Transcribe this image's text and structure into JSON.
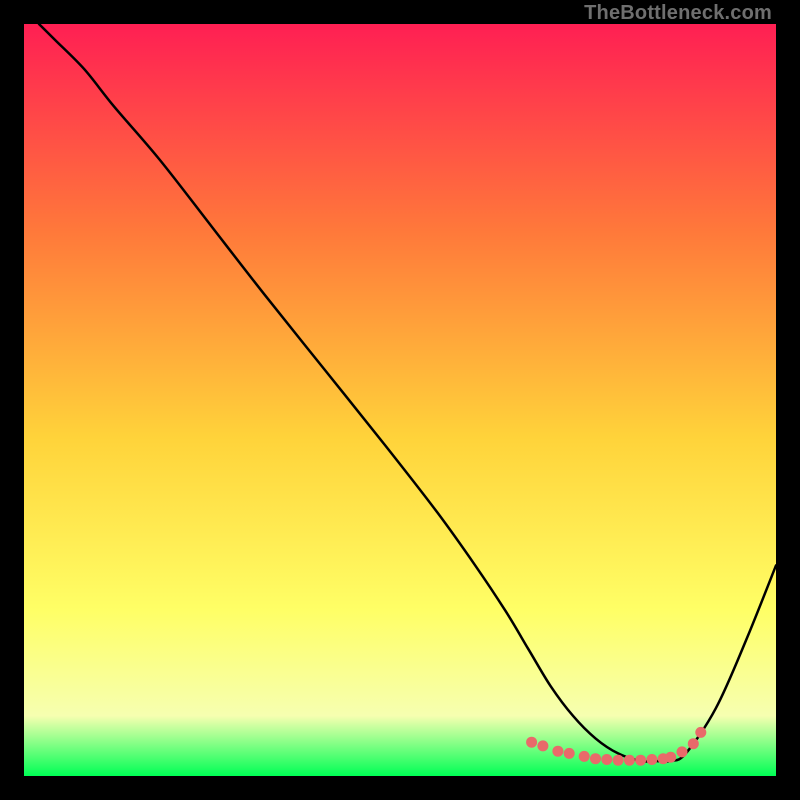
{
  "watermark": "TheBottleneck.com",
  "colors": {
    "curve": "#000000",
    "dots": "#e96a6a",
    "gradient_top": "#ff1f53",
    "gradient_mid1": "#ff7a3a",
    "gradient_mid2": "#ffd33a",
    "gradient_mid3": "#ffff66",
    "gradient_mid4": "#f6ffb0",
    "gradient_bottom": "#00ff55",
    "frame": "#000000"
  },
  "chart_data": {
    "type": "line",
    "title": "",
    "xlabel": "",
    "ylabel": "",
    "xlim": [
      0,
      100
    ],
    "ylim": [
      0,
      100
    ],
    "series": [
      {
        "name": "bottleneck-curve",
        "x": [
          2,
          4,
          8,
          12,
          18,
          25,
          32,
          40,
          48,
          55,
          60,
          64,
          67,
          70,
          73,
          76,
          79,
          82,
          84,
          86,
          88,
          92,
          96,
          100
        ],
        "y": [
          100,
          98,
          94,
          89,
          82,
          73,
          64,
          54,
          44,
          35,
          28,
          22,
          17,
          12,
          8,
          5,
          3,
          2,
          2,
          2,
          3,
          9,
          18,
          28
        ]
      }
    ],
    "highlight_points": {
      "name": "optimal-range-dots",
      "x": [
        67.5,
        69,
        71,
        72.5,
        74.5,
        76,
        77.5,
        79,
        80.5,
        82,
        83.5,
        85,
        86,
        87.5,
        89,
        90
      ],
      "y": [
        4.5,
        4,
        3.3,
        3,
        2.6,
        2.3,
        2.2,
        2.1,
        2.1,
        2.1,
        2.2,
        2.3,
        2.5,
        3.2,
        4.3,
        5.8
      ]
    }
  }
}
